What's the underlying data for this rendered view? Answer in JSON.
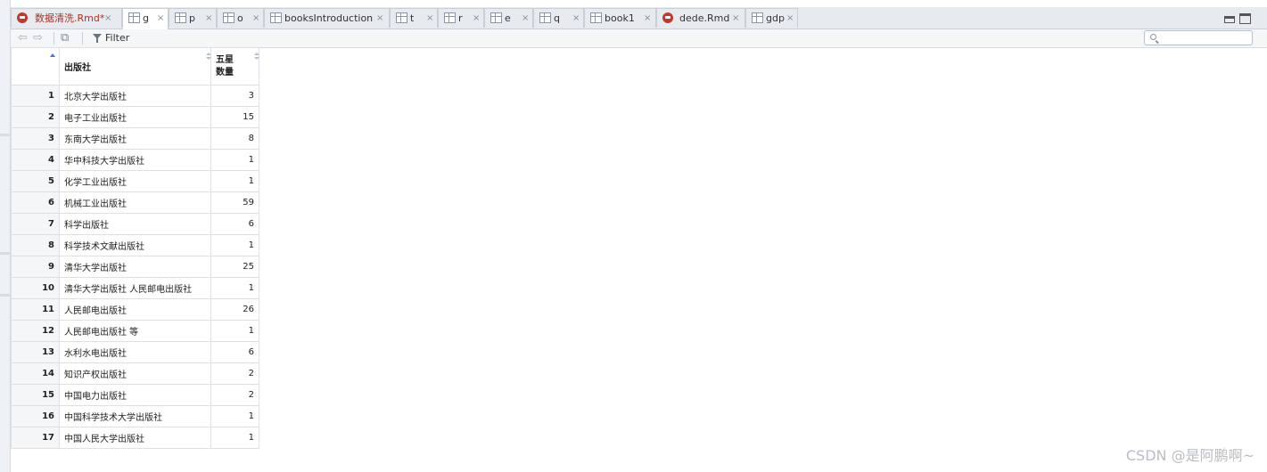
{
  "tabs": [
    {
      "label": "数据清洗.Rmd*",
      "icon": "rmd-icon",
      "active": false
    },
    {
      "label": "g",
      "icon": "grid-icon",
      "active": true
    },
    {
      "label": "p",
      "icon": "grid-icon",
      "active": false
    },
    {
      "label": "o",
      "icon": "grid-icon",
      "active": false
    },
    {
      "label": "booksIntroduction",
      "icon": "grid-icon",
      "active": false
    },
    {
      "label": "t",
      "icon": "grid-icon",
      "active": false
    },
    {
      "label": "r",
      "icon": "grid-icon",
      "active": false
    },
    {
      "label": "e",
      "icon": "grid-icon",
      "active": false
    },
    {
      "label": "q",
      "icon": "grid-icon",
      "active": false
    },
    {
      "label": "book1",
      "icon": "grid-icon",
      "active": false
    },
    {
      "label": "dede.Rmd",
      "icon": "rmd-icon",
      "active": false
    },
    {
      "label": "gdp",
      "icon": "grid-icon",
      "active": false
    }
  ],
  "close_glyph": "×",
  "toolbar": {
    "back_glyph": "⇦",
    "forward_glyph": "⇨",
    "popout_glyph": "⧉",
    "filter_label": "Filter"
  },
  "table": {
    "columns": [
      "出版社",
      "五星\n数量"
    ],
    "rows": [
      {
        "n": "1",
        "publisher": "北京大学出版社",
        "count": "3"
      },
      {
        "n": "2",
        "publisher": "电子工业出版社",
        "count": "15"
      },
      {
        "n": "3",
        "publisher": "东南大学出版社",
        "count": "8"
      },
      {
        "n": "4",
        "publisher": "华中科技大学出版社",
        "count": "1"
      },
      {
        "n": "5",
        "publisher": "化学工业出版社",
        "count": "1"
      },
      {
        "n": "6",
        "publisher": "机械工业出版社",
        "count": "59"
      },
      {
        "n": "7",
        "publisher": "科学出版社",
        "count": "6"
      },
      {
        "n": "8",
        "publisher": "科学技术文献出版社",
        "count": "1"
      },
      {
        "n": "9",
        "publisher": "清华大学出版社",
        "count": "25"
      },
      {
        "n": "10",
        "publisher": "清华大学出版社 人民邮电出版社",
        "count": "1"
      },
      {
        "n": "11",
        "publisher": "人民邮电出版社",
        "count": "26"
      },
      {
        "n": "12",
        "publisher": "人民邮电出版社 等",
        "count": "1"
      },
      {
        "n": "13",
        "publisher": "水利水电出版社",
        "count": "6"
      },
      {
        "n": "14",
        "publisher": "知识产权出版社",
        "count": "2"
      },
      {
        "n": "15",
        "publisher": "中国电力出版社",
        "count": "2"
      },
      {
        "n": "16",
        "publisher": "中国科学技术大学出版社",
        "count": "1"
      },
      {
        "n": "17",
        "publisher": "中国人民大学出版社",
        "count": "1"
      }
    ]
  },
  "watermark": "CSDN @是阿鹏啊~",
  "colors": {
    "active_tab": "#ffffff",
    "tab_bar": "#e7ebf0",
    "sort_active": "#2f7ed8",
    "rmd_label": "#b03020"
  }
}
